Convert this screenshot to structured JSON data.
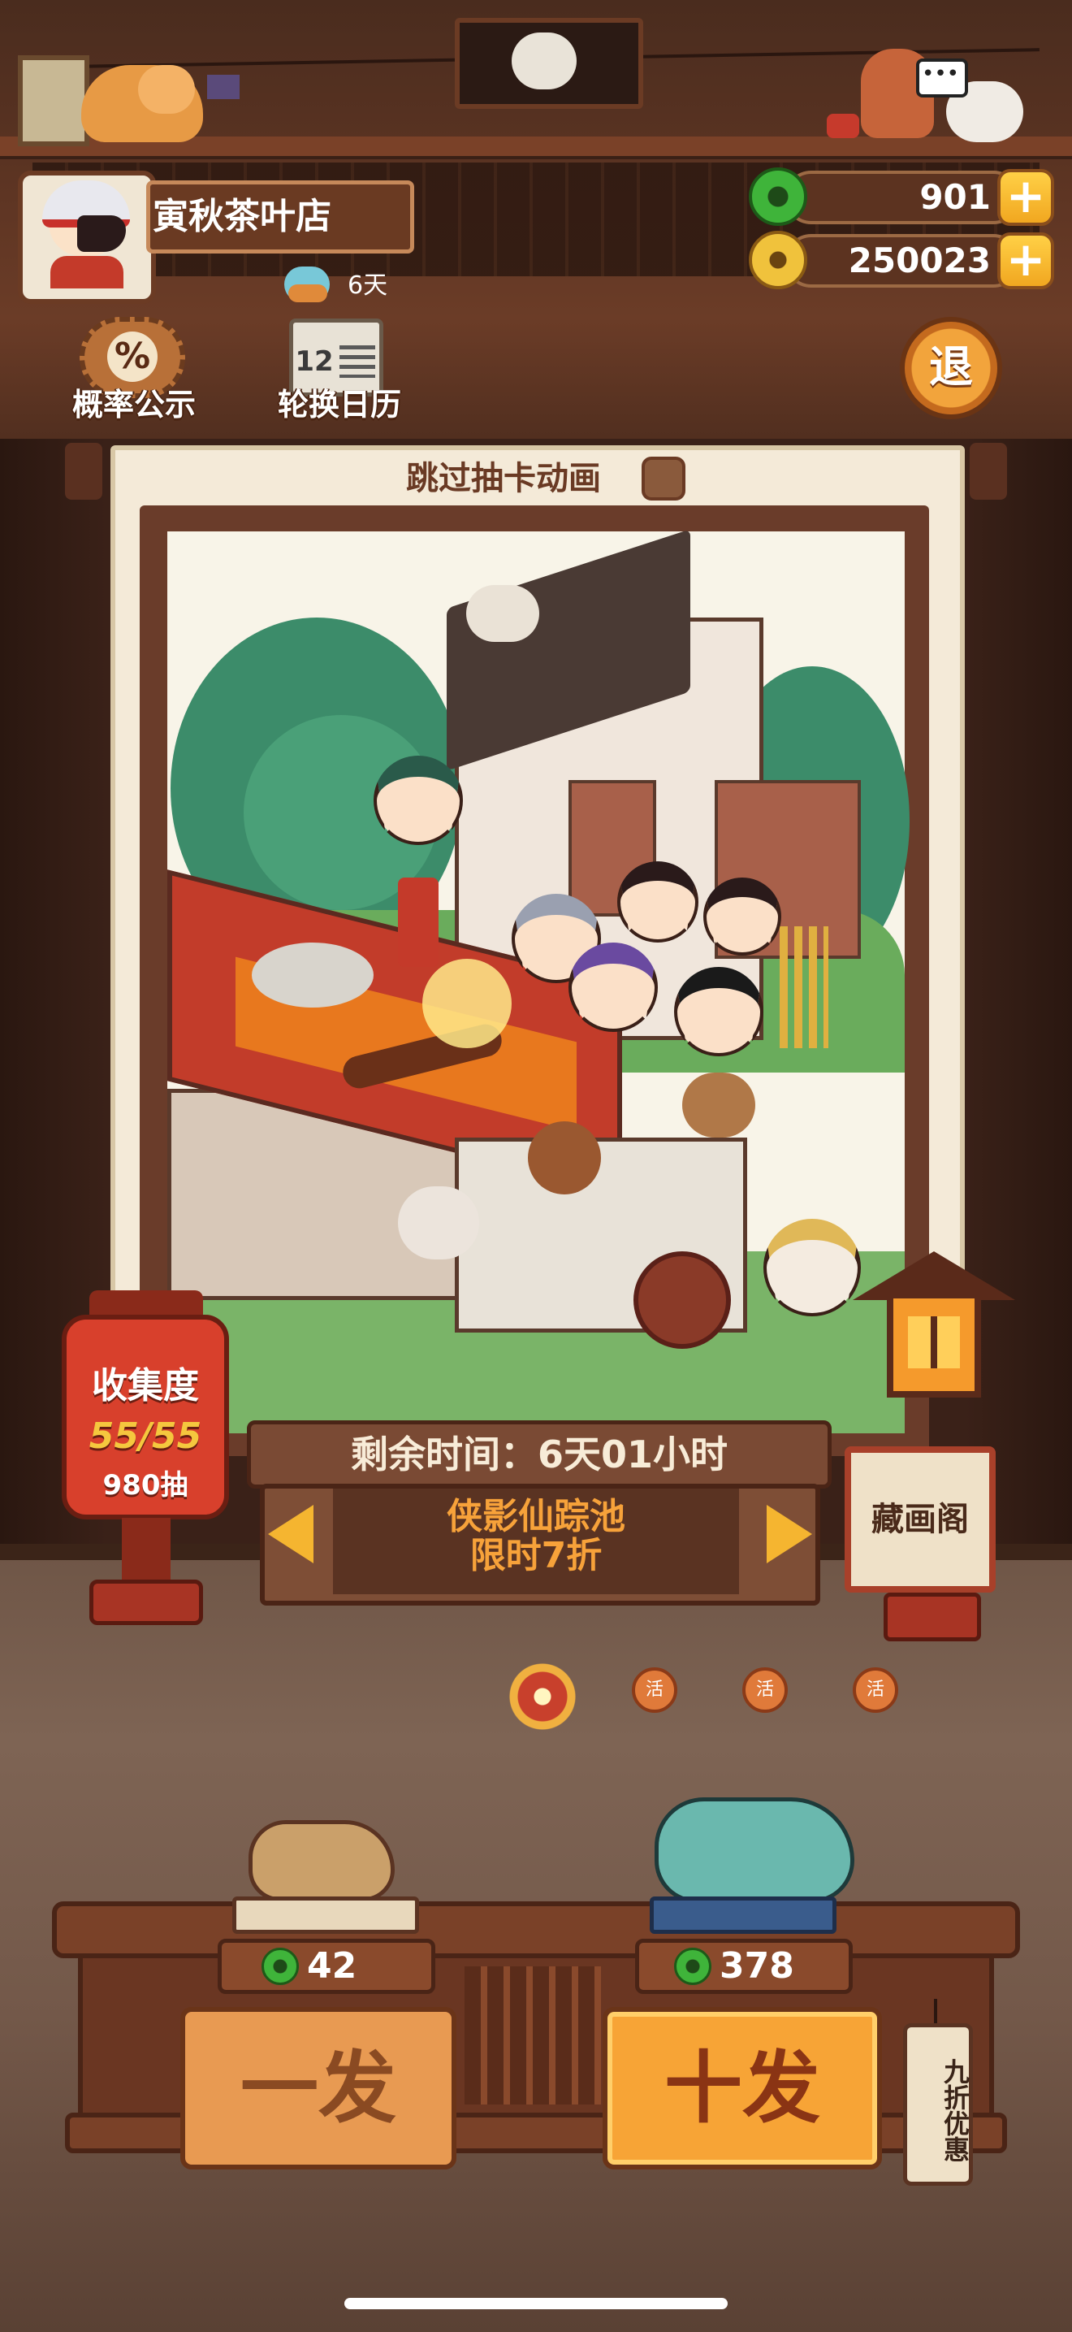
{
  "player": {
    "shop_name": "寅秋茶叶店",
    "days": "6天"
  },
  "currency": {
    "jade": "901",
    "coins": "250023",
    "add_symbol": "+"
  },
  "top_buttons": {
    "probability_label": "概率公示",
    "probability_symbol": "%",
    "calendar_label": "轮换日历",
    "calendar_number": "12",
    "exit_label": "退"
  },
  "card": {
    "skip_animation_label": "跳过抽卡动画",
    "skip_checked": false
  },
  "banner": {
    "remaining_time": "剩余时间：6天01小时",
    "pool_name": "侠影仙踪池",
    "pool_sale": "限时7折"
  },
  "collection": {
    "label": "收集度",
    "value": "55/55",
    "draws": "980抽"
  },
  "gallery": {
    "label": "藏画阁"
  },
  "pager": {
    "dot_label": "活",
    "active_index": 0,
    "count": 4
  },
  "draw": {
    "single_label": "一发",
    "single_price": "42",
    "ten_label": "十发",
    "ten_price": "378",
    "discount": "九折优惠"
  },
  "colors": {
    "accent_orange": "#f7a436",
    "jade_green": "#3fb43a",
    "coin_gold": "#f0c23c",
    "lantern_red": "#d8402c",
    "wood_dark": "#4a2416"
  }
}
